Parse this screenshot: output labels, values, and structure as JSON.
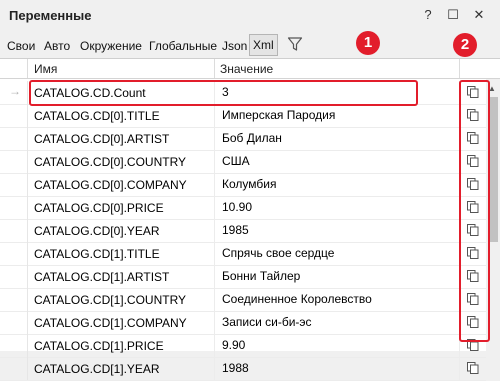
{
  "window": {
    "title": "Переменные",
    "help_label": "?",
    "maximize_label": "☐",
    "close_label": "✕"
  },
  "toolbar": {
    "tabs": [
      {
        "label": "Свои"
      },
      {
        "label": "Авто"
      },
      {
        "label": "Окружение"
      },
      {
        "label": "Глобальные"
      },
      {
        "label": "Json"
      },
      {
        "label": "Xml"
      }
    ],
    "selected_tab": "Xml"
  },
  "table": {
    "columns": [
      "Имя",
      "Значение"
    ],
    "current_row_marker": "→",
    "rows": [
      {
        "name": "CATALOG.CD.Count",
        "value": "3"
      },
      {
        "name": "CATALOG.CD[0].TITLE",
        "value": "Имперская Пародия"
      },
      {
        "name": "CATALOG.CD[0].ARTIST",
        "value": "Боб Дилан"
      },
      {
        "name": "CATALOG.CD[0].COUNTRY",
        "value": "США"
      },
      {
        "name": "CATALOG.CD[0].COMPANY",
        "value": "Колумбия"
      },
      {
        "name": "CATALOG.CD[0].PRICE",
        "value": "10.90"
      },
      {
        "name": "CATALOG.CD[0].YEAR",
        "value": "1985"
      },
      {
        "name": "CATALOG.CD[1].TITLE",
        "value": "Спрячь свое сердце"
      },
      {
        "name": "CATALOG.CD[1].ARTIST",
        "value": "Бонни Тайлер"
      },
      {
        "name": "CATALOG.CD[1].COUNTRY",
        "value": "Соединенное Королевство"
      },
      {
        "name": "CATALOG.CD[1].COMPANY",
        "value": "Записи си-би-эс"
      },
      {
        "name": "CATALOG.CD[1].PRICE",
        "value": "9.90"
      },
      {
        "name": "CATALOG.CD[1].YEAR",
        "value": "1988"
      }
    ]
  },
  "annotations": [
    {
      "label": "1"
    },
    {
      "label": "2"
    }
  ],
  "colors": {
    "highlight": "#e21d2b",
    "window_bg": "#f0f0f0",
    "grid_bg": "#ffffff"
  }
}
